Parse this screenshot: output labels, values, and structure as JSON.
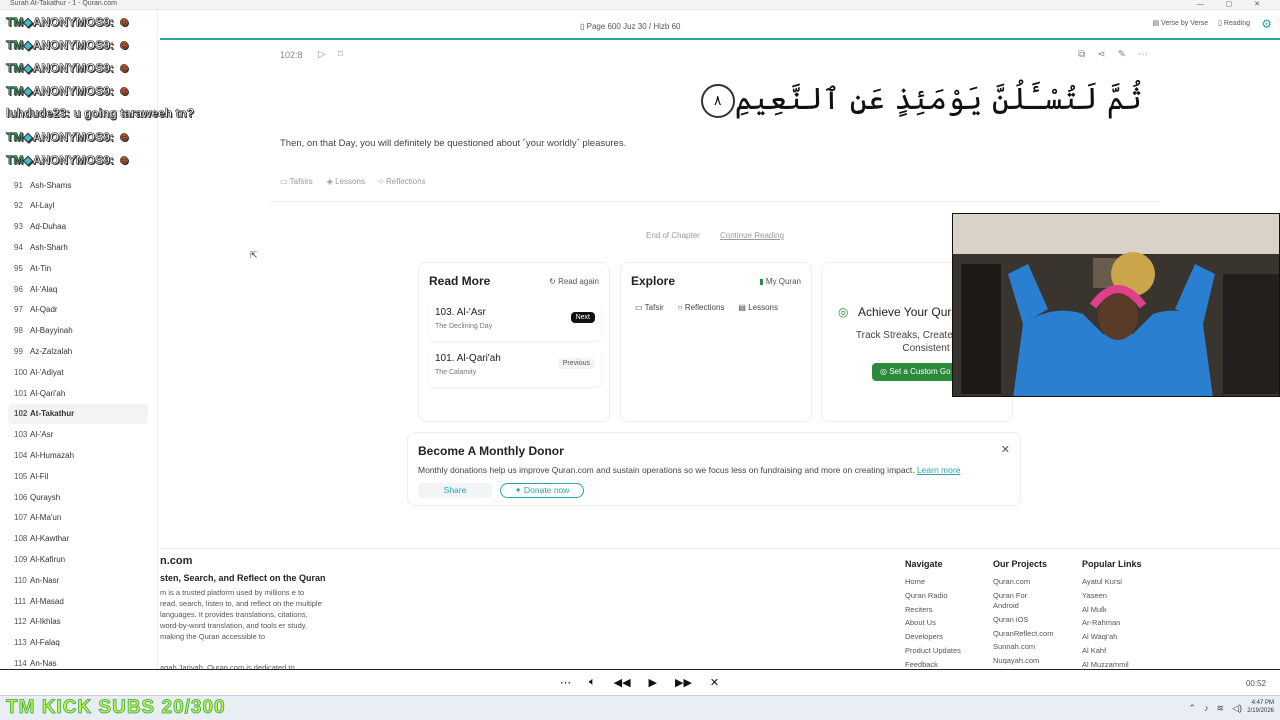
{
  "window": {
    "title": "Surah At-Takathur - 1 - Quran.com",
    "controls": "— ▢ ✕"
  },
  "header": {
    "page_info": "Page 600  Juz 30 / Hizb 60",
    "view_verse": "Verse by Verse",
    "view_reading": "Reading",
    "settings_icon": "gear-icon"
  },
  "sidebar": {
    "items": [
      {
        "num": "91",
        "label": "Ash-Shams"
      },
      {
        "num": "92",
        "label": "Al-Layl"
      },
      {
        "num": "93",
        "label": "Ad-Duhaa"
      },
      {
        "num": "94",
        "label": "Ash-Sharh"
      },
      {
        "num": "95",
        "label": "At-Tin"
      },
      {
        "num": "96",
        "label": "Al-'Alaq"
      },
      {
        "num": "97",
        "label": "Al-Qadr"
      },
      {
        "num": "98",
        "label": "Al-Bayyinah"
      },
      {
        "num": "99",
        "label": "Az-Zalzalah"
      },
      {
        "num": "100",
        "label": "Al-'Adiyat"
      },
      {
        "num": "101",
        "label": "Al-Qari'ah"
      },
      {
        "num": "102",
        "label": "At-Takathur"
      },
      {
        "num": "103",
        "label": "Al-'Asr"
      },
      {
        "num": "104",
        "label": "Al-Humazah"
      },
      {
        "num": "105",
        "label": "Al-Fil"
      },
      {
        "num": "106",
        "label": "Quraysh"
      },
      {
        "num": "107",
        "label": "Al-Ma'un"
      },
      {
        "num": "108",
        "label": "Al-Kawthar"
      },
      {
        "num": "109",
        "label": "Al-Kafirun"
      },
      {
        "num": "110",
        "label": "An-Nasr"
      },
      {
        "num": "111",
        "label": "Al-Masad"
      },
      {
        "num": "112",
        "label": "Al-Ikhlas"
      },
      {
        "num": "113",
        "label": "Al-Falaq"
      },
      {
        "num": "114",
        "label": "An-Nas"
      }
    ],
    "active_index": 11
  },
  "chat": {
    "lines": [
      {
        "badge": "TM",
        "name": "ANONYMOS9:",
        "msg": ""
      },
      {
        "badge": "TM",
        "name": "ANONYMOS9:",
        "msg": ""
      },
      {
        "badge": "TM",
        "name": "ANONYMOS9:",
        "msg": ""
      },
      {
        "badge": "TM",
        "name": "ANONYMOS9:",
        "msg": ""
      },
      {
        "badge": "",
        "name": "luhdude23:",
        "msg": "u going taraweeh tn?"
      },
      {
        "badge": "TM",
        "name": "ANONYMOS9:",
        "msg": ""
      },
      {
        "badge": "TM",
        "name": "ANONYMOS9:",
        "msg": ""
      }
    ]
  },
  "verse": {
    "key": "102:8",
    "arabic": "ثُمَّ لَتُسْـَٔلُنَّ يَوْمَئِذٍ عَنِ ٱلنَّعِيمِ",
    "number_ar": "٨",
    "translation": "Then, on that Day, you will definitely be questioned about ˹your worldly˺ pleasures.",
    "tabs": [
      "Tafsirs",
      "Lessons",
      "Reflections"
    ]
  },
  "end_chapter": {
    "label": "End of Chapter",
    "continue": "Continue Reading"
  },
  "read_more": {
    "title": "Read More",
    "action": "Read again",
    "next": {
      "title": "103. Al-'Asr",
      "subtitle": "The Declining Day",
      "badge": "Next"
    },
    "prev": {
      "title": "101. Al-Qari'ah",
      "subtitle": "The Calamity",
      "badge": "Previous"
    }
  },
  "explore": {
    "title": "Explore",
    "action": "My Quran",
    "links": [
      "Tafsir",
      "Reflections",
      "Lessons"
    ]
  },
  "goals": {
    "title": "Achieve Your Qura",
    "desc": "Track Streaks, Create Cus Stay Consistent",
    "button": "Set a Custom Go"
  },
  "donor": {
    "title": "Become A Monthly Donor",
    "text": "Monthly donations help us improve Quran.com and sustain operations so we focus less on fundraising and more on creating impact.",
    "learn_more": "Learn more",
    "share": "Share",
    "donate": "Donate now"
  },
  "footer": {
    "brand": "n.com",
    "tagline": "sten, Search, and Reflect on the Quran",
    "desc": "m is a trusted platform used by millions e to read, search, listen to, and reflect on the multiple languages. It provides translations, citations, word-by-word translation, and tools er study, making the Quran accessible to",
    "desc2": "aqah Jariyah. Quran.com is dedicated to",
    "columns": [
      {
        "title": "Navigate",
        "links": [
          "Home",
          "Quran Radio",
          "Reciters",
          "About Us",
          "Developers",
          "Product Updates",
          "Feedback"
        ]
      },
      {
        "title": "Our Projects",
        "links": [
          "Quran.com",
          "Quran For Android",
          "Quran iOS",
          "QuranReflect.com",
          "Sunnah.com",
          "Nuqayah.com"
        ]
      },
      {
        "title": "Popular Links",
        "links": [
          "Ayatul Kursi",
          "Yaseen",
          "Al Mulk",
          "Ar-Rahman",
          "Al Waqi'ah",
          "Al Kahf",
          "Al Muzzammil"
        ]
      }
    ]
  },
  "player": {
    "time": "00:52"
  },
  "taskbar": {
    "overlay_text": "TM KICK SUBS 20/300",
    "time": "4:47 PM",
    "date": "2/19/2026"
  }
}
